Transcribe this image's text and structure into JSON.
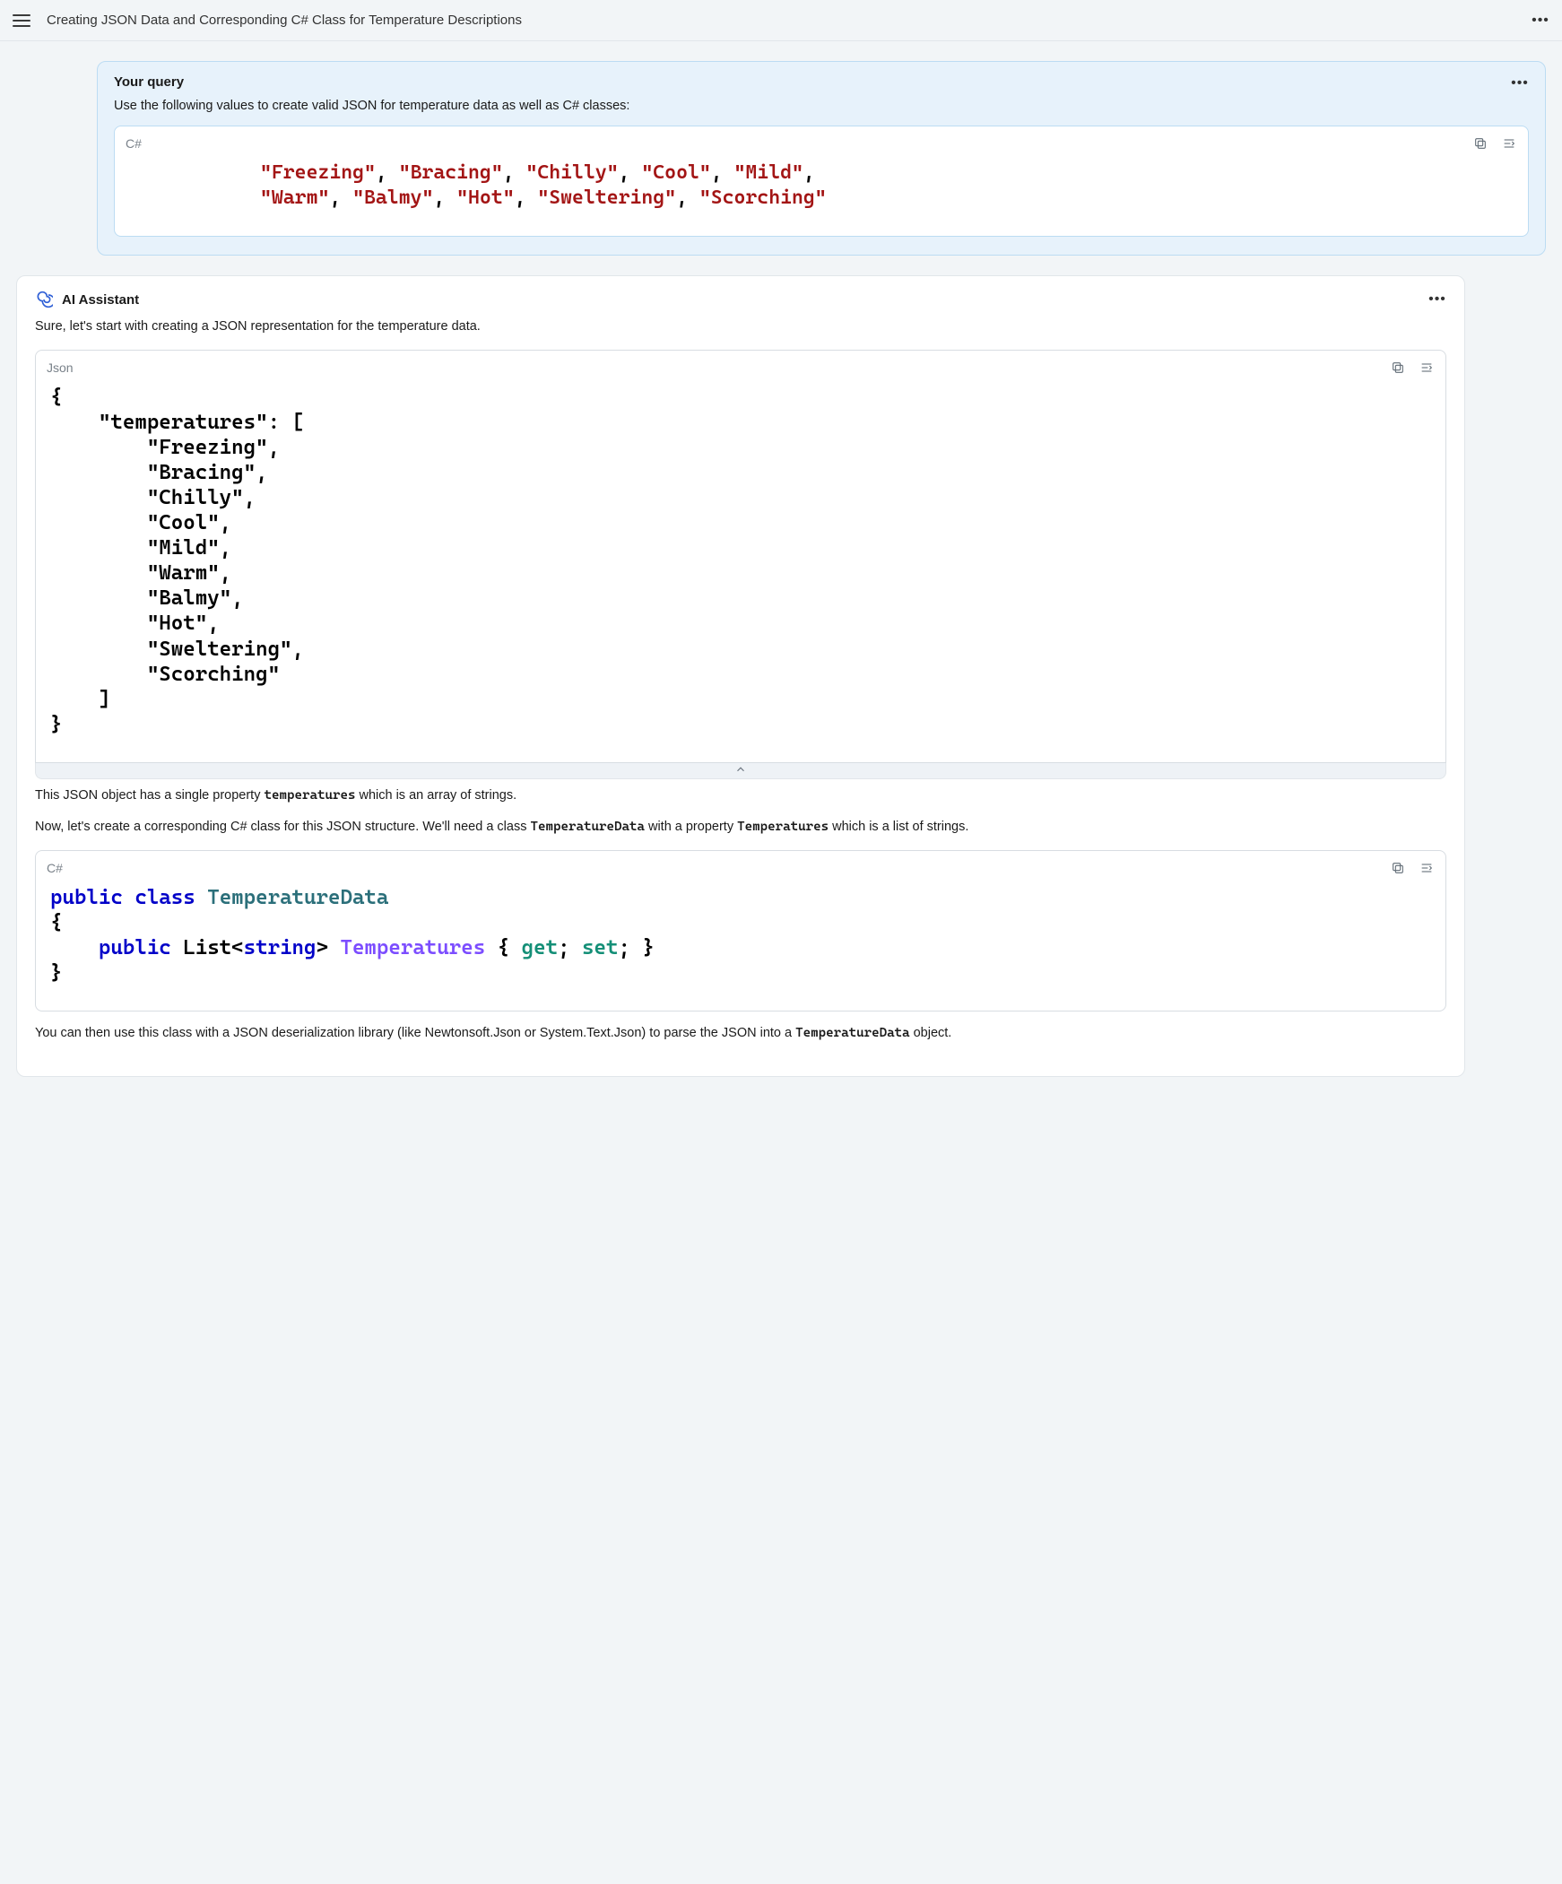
{
  "header": {
    "title": "Creating JSON Data and Corresponding C# Class for Temperature Descriptions"
  },
  "query": {
    "heading": "Your query",
    "prompt": "Use the following values to create valid JSON for temperature data as well as C# classes:",
    "code_lang": "C#",
    "code_tokens_line1": [
      "\"Freezing\"",
      ", ",
      "\"Bracing\"",
      ", ",
      "\"Chilly\"",
      ", ",
      "\"Cool\"",
      ", ",
      "\"Mild\"",
      ","
    ],
    "code_tokens_line2": [
      "\"Warm\"",
      ", ",
      "\"Balmy\"",
      ", ",
      "\"Hot\"",
      ", ",
      "\"Sweltering\"",
      ", ",
      "\"Scorching\""
    ]
  },
  "assistant": {
    "title": "AI Assistant",
    "intro": "Sure, let's start with creating a JSON representation for the temperature data.",
    "json_lang": "Json",
    "json_lines": [
      "{",
      "    \"temperatures\": [",
      "        \"Freezing\",",
      "        \"Bracing\",",
      "        \"Chilly\",",
      "        \"Cool\",",
      "        \"Mild\",",
      "        \"Warm\",",
      "        \"Balmy\",",
      "        \"Hot\",",
      "        \"Sweltering\",",
      "        \"Scorching\"",
      "    ]",
      "}"
    ],
    "explain1_pre": "This JSON object has a single property ",
    "explain1_mono": "temperatures",
    "explain1_post": " which is an array of strings.",
    "explain2_pre": "Now, let's create a corresponding C# class for this JSON structure. We'll need a class ",
    "explain2_mono1": "TemperatureData",
    "explain2_mid": " with a property ",
    "explain2_mono2": "Temperatures",
    "explain2_post": " which is a list of strings.",
    "csharp_lang": "C#",
    "csharp": {
      "l1": {
        "public": "public",
        "class": "class",
        "name": "TemperatureData"
      },
      "l2": "{",
      "l3": {
        "public": "public",
        "list": "List",
        "open": "<",
        "string": "string",
        "close": ">",
        "prop": "Temperatures",
        "ob": "{",
        "get": "get",
        "semi1": ";",
        "set": "set",
        "semi2": ";",
        "cb": "}"
      },
      "l4": "}"
    },
    "tail_pre": "You can then use this class with a JSON deserialization library (like Newtonsoft.Json or System.Text.Json) to parse the JSON into a ",
    "tail_mono": "TemperatureData",
    "tail_post": " object."
  }
}
